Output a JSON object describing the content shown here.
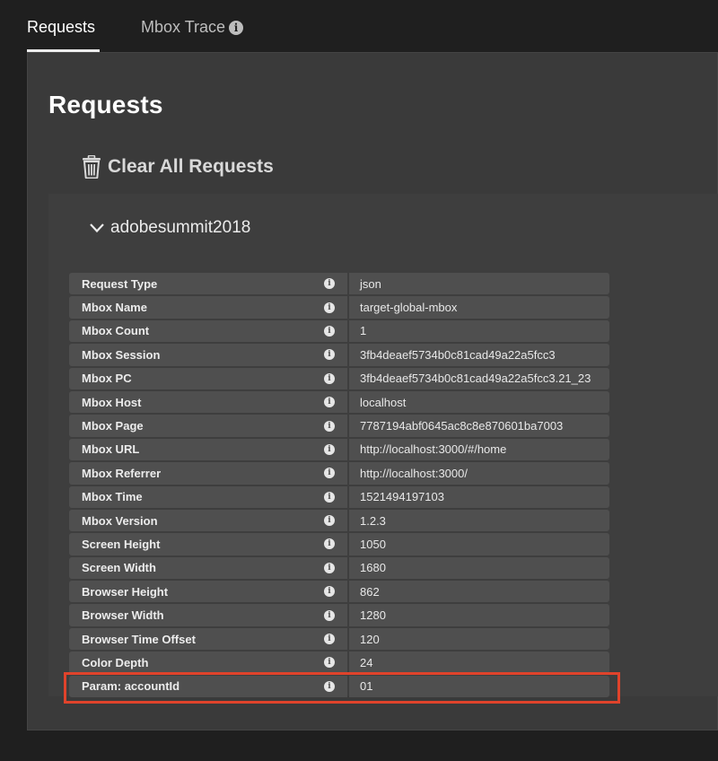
{
  "tabs": [
    {
      "label": "Requests",
      "active": true
    },
    {
      "label": "Mbox Trace",
      "active": false,
      "info_icon": "info-icon"
    }
  ],
  "page": {
    "title": "Requests",
    "clear_label": "Clear All Requests",
    "clear_icon": "trash-icon"
  },
  "group": {
    "name": "adobesummit2018",
    "expanded": true,
    "chevron_icon": "chevron-down-icon"
  },
  "rows": [
    {
      "key": "Request Type",
      "value": "json"
    },
    {
      "key": "Mbox Name",
      "value": "target-global-mbox"
    },
    {
      "key": "Mbox Count",
      "value": "1"
    },
    {
      "key": "Mbox Session",
      "value": "3fb4deaef5734b0c81cad49a22a5fcc3"
    },
    {
      "key": "Mbox PC",
      "value": "3fb4deaef5734b0c81cad49a22a5fcc3.21_23"
    },
    {
      "key": "Mbox Host",
      "value": "localhost"
    },
    {
      "key": "Mbox Page",
      "value": "7787194abf0645ac8c8e870601ba7003"
    },
    {
      "key": "Mbox URL",
      "value": "http://localhost:3000/#/home"
    },
    {
      "key": "Mbox Referrer",
      "value": "http://localhost:3000/"
    },
    {
      "key": "Mbox Time",
      "value": "1521494197103"
    },
    {
      "key": "Mbox Version",
      "value": "1.2.3"
    },
    {
      "key": "Screen Height",
      "value": "1050"
    },
    {
      "key": "Screen Width",
      "value": "1680"
    },
    {
      "key": "Browser Height",
      "value": "862"
    },
    {
      "key": "Browser Width",
      "value": "1280"
    },
    {
      "key": "Browser Time Offset",
      "value": "120"
    },
    {
      "key": "Color Depth",
      "value": "24"
    },
    {
      "key": "Param: accountId",
      "value": "01"
    }
  ],
  "colors": {
    "background": "#1f1f1f",
    "panel": "#3a3a3a",
    "cell": "#4f4f4f",
    "highlight": "#e0432b"
  }
}
